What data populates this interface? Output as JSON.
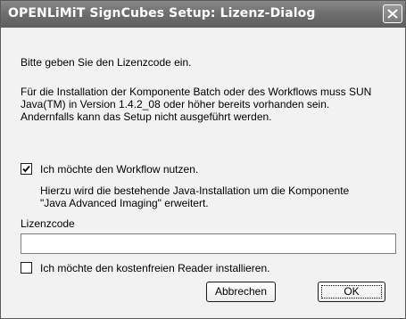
{
  "window": {
    "title": "OPENLiMiT SignCubes Setup: Lizenz-Dialog"
  },
  "intro": "Bitte geben Sie den Lizenzcode ein.",
  "requirement_lines": [
    "Für die Installation der Komponente Batch oder des Workflows muss SUN",
    "Java(TM) in Version 1.4.2_08 oder höher bereits vorhanden sein.",
    "Andernfalls kann das Setup nicht ausgeführt werden."
  ],
  "workflow_checkbox": {
    "label": "Ich möchte den Workflow nutzen.",
    "checked": true
  },
  "workflow_info_lines": [
    "Hierzu wird die bestehende Java-Installation um die Komponente",
    "\"Java Advanced Imaging\" erweitert."
  ],
  "license_field": {
    "label": "Lizenzcode",
    "value": ""
  },
  "reader_checkbox": {
    "label": "Ich möchte den kostenfreien Reader installieren.",
    "checked": false
  },
  "buttons": {
    "cancel": "Abbrechen",
    "ok": "OK"
  }
}
